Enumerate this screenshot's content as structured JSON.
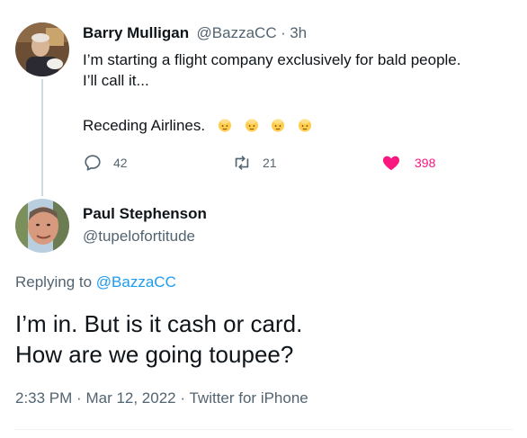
{
  "parent_tweet": {
    "author_name": "Barry Mulligan",
    "author_handle": "@BazzaCC",
    "separator": "·",
    "time": "3h",
    "line1": "I’m starting a flight company exclusively for bald people.",
    "line2": "I’ll call it...",
    "line3": "Receding Airlines.",
    "emoji": [
      "bald-person-emoji",
      "bald-person-emoji",
      "bald-person-emoji",
      "bald-person-emoji"
    ],
    "reply_count": "42",
    "retweet_count": "21",
    "like_count": "398",
    "colors": {
      "like": "#f91880",
      "text": "#0f1419",
      "muted": "#536471"
    }
  },
  "reply_tweet": {
    "author_name": "Paul Stephenson",
    "author_handle": "@tupelofortitude",
    "replying_prefix": "Replying to",
    "replying_to": "@BazzaCC",
    "line1": "I’m in. But is it cash or card.",
    "line2": "How are we going toupee?",
    "time": "2:33 PM",
    "dot1": "·",
    "date": "Mar 12, 2022",
    "dot2": "·",
    "source": "Twitter for iPhone",
    "colors": {
      "link": "#1d9bf0"
    }
  }
}
